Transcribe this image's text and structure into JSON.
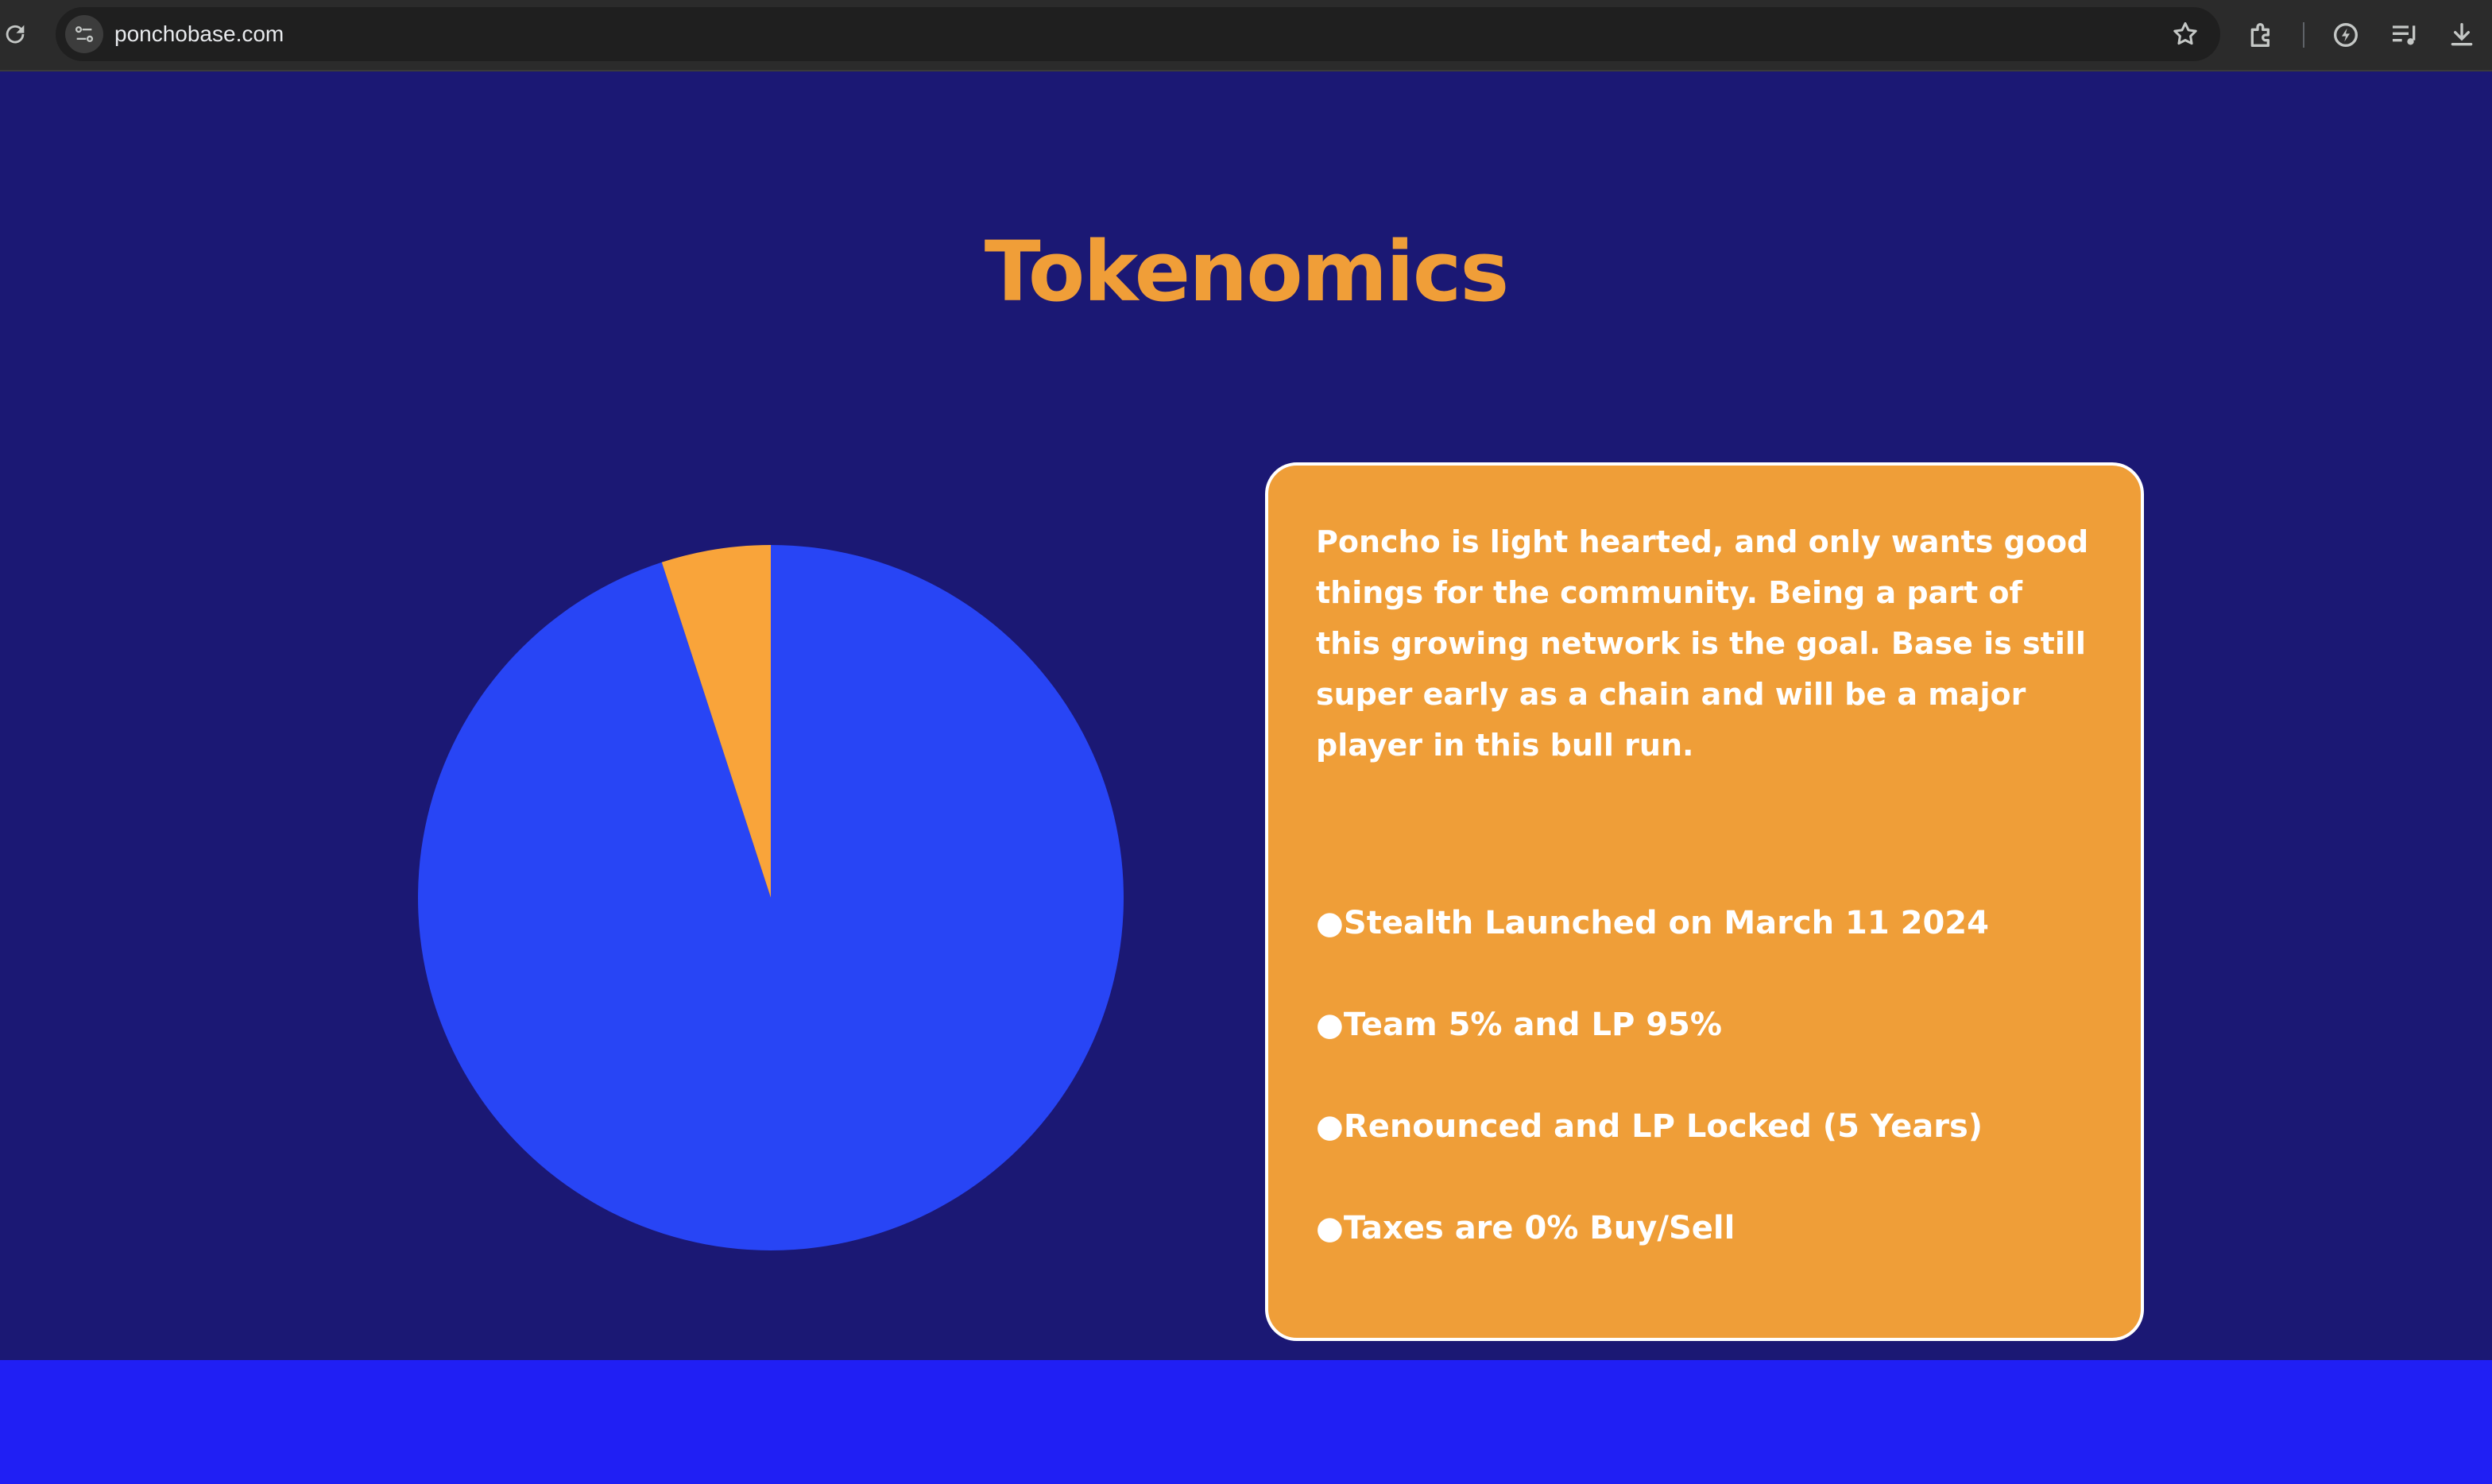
{
  "browser": {
    "url": "ponchobase.com"
  },
  "page": {
    "title": "Tokenomics",
    "description": "Poncho is light hearted, and only wants good things for the community. Being a part of this growing network is the goal. Base is still super early as a chain and will be a major player in this bull run.",
    "bullets": [
      "●Stealth Launched on March 11 2024",
      "●Team 5% and LP 95%",
      "●Renounced and LP Locked (5 Years)",
      "●Taxes are 0% Buy/Sell"
    ]
  },
  "chart_data": {
    "type": "pie",
    "slices": [
      {
        "value": 95,
        "color": "#2845f5"
      },
      {
        "value": 5,
        "color": "#f9a43a"
      }
    ]
  },
  "colors": {
    "background": "#1b1874",
    "accent": "#f09e38",
    "card": "#ef9e38",
    "footer_band": "#201ff4"
  }
}
